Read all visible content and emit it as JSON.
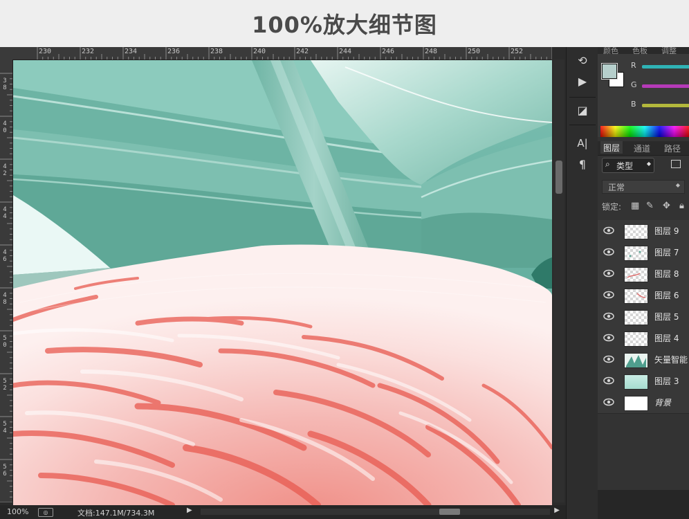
{
  "page_title": "100%放大细节图",
  "rulers": {
    "top_labels": [
      "230",
      "232",
      "234",
      "236",
      "238",
      "240",
      "242",
      "244",
      "246",
      "248",
      "250",
      "252"
    ],
    "left_labels": [
      [
        "3",
        "8"
      ],
      [
        "4",
        "0"
      ],
      [
        "4",
        "2"
      ],
      [
        "4",
        "4"
      ],
      [
        "4",
        "6"
      ],
      [
        "4",
        "8"
      ],
      [
        "5",
        "0"
      ],
      [
        "5",
        "2"
      ],
      [
        "5",
        "4"
      ],
      [
        "5",
        "6"
      ]
    ]
  },
  "status_bar": {
    "zoom": "100%",
    "doc_info": "文档:147.1M/734.3M",
    "arrow": "▶"
  },
  "tools": [
    {
      "name": "history-icon",
      "glyph": "⟲"
    },
    {
      "name": "play-action-icon",
      "glyph": "▶"
    },
    {
      "name": "3d-icon",
      "glyph": "◪"
    },
    {
      "name": "character-icon",
      "glyph": "A|"
    },
    {
      "name": "paragraph-icon",
      "glyph": "¶"
    }
  ],
  "color_panel": {
    "tabs": [
      "颜色",
      "色板",
      "调整"
    ],
    "channels": [
      {
        "label": "R",
        "color": "#2fb3b5"
      },
      {
        "label": "G",
        "color": "#b53ab8"
      },
      {
        "label": "B",
        "color": "#b3b83c"
      }
    ],
    "foreground_color": "#b6cfcc",
    "background_color": "#ffffff"
  },
  "layers_panel": {
    "tabs": [
      "图层",
      "通道",
      "路径"
    ],
    "filter_label": "类型",
    "blend_mode": "正常",
    "lock_label": "锁定:",
    "layers": [
      {
        "name": "图层 9",
        "thumb": "transparent"
      },
      {
        "name": "图层 7",
        "thumb": "transparent-dots"
      },
      {
        "name": "图层 8",
        "thumb": "transparent-red"
      },
      {
        "name": "图层 6",
        "thumb": "transparent-red"
      },
      {
        "name": "图层 5",
        "thumb": "transparent"
      },
      {
        "name": "图层 4",
        "thumb": "transparent"
      },
      {
        "name": "矢量智能",
        "thumb": "leaves"
      },
      {
        "name": "图层 3",
        "thumb": "mint"
      },
      {
        "name": "背景",
        "thumb": "white"
      }
    ]
  }
}
